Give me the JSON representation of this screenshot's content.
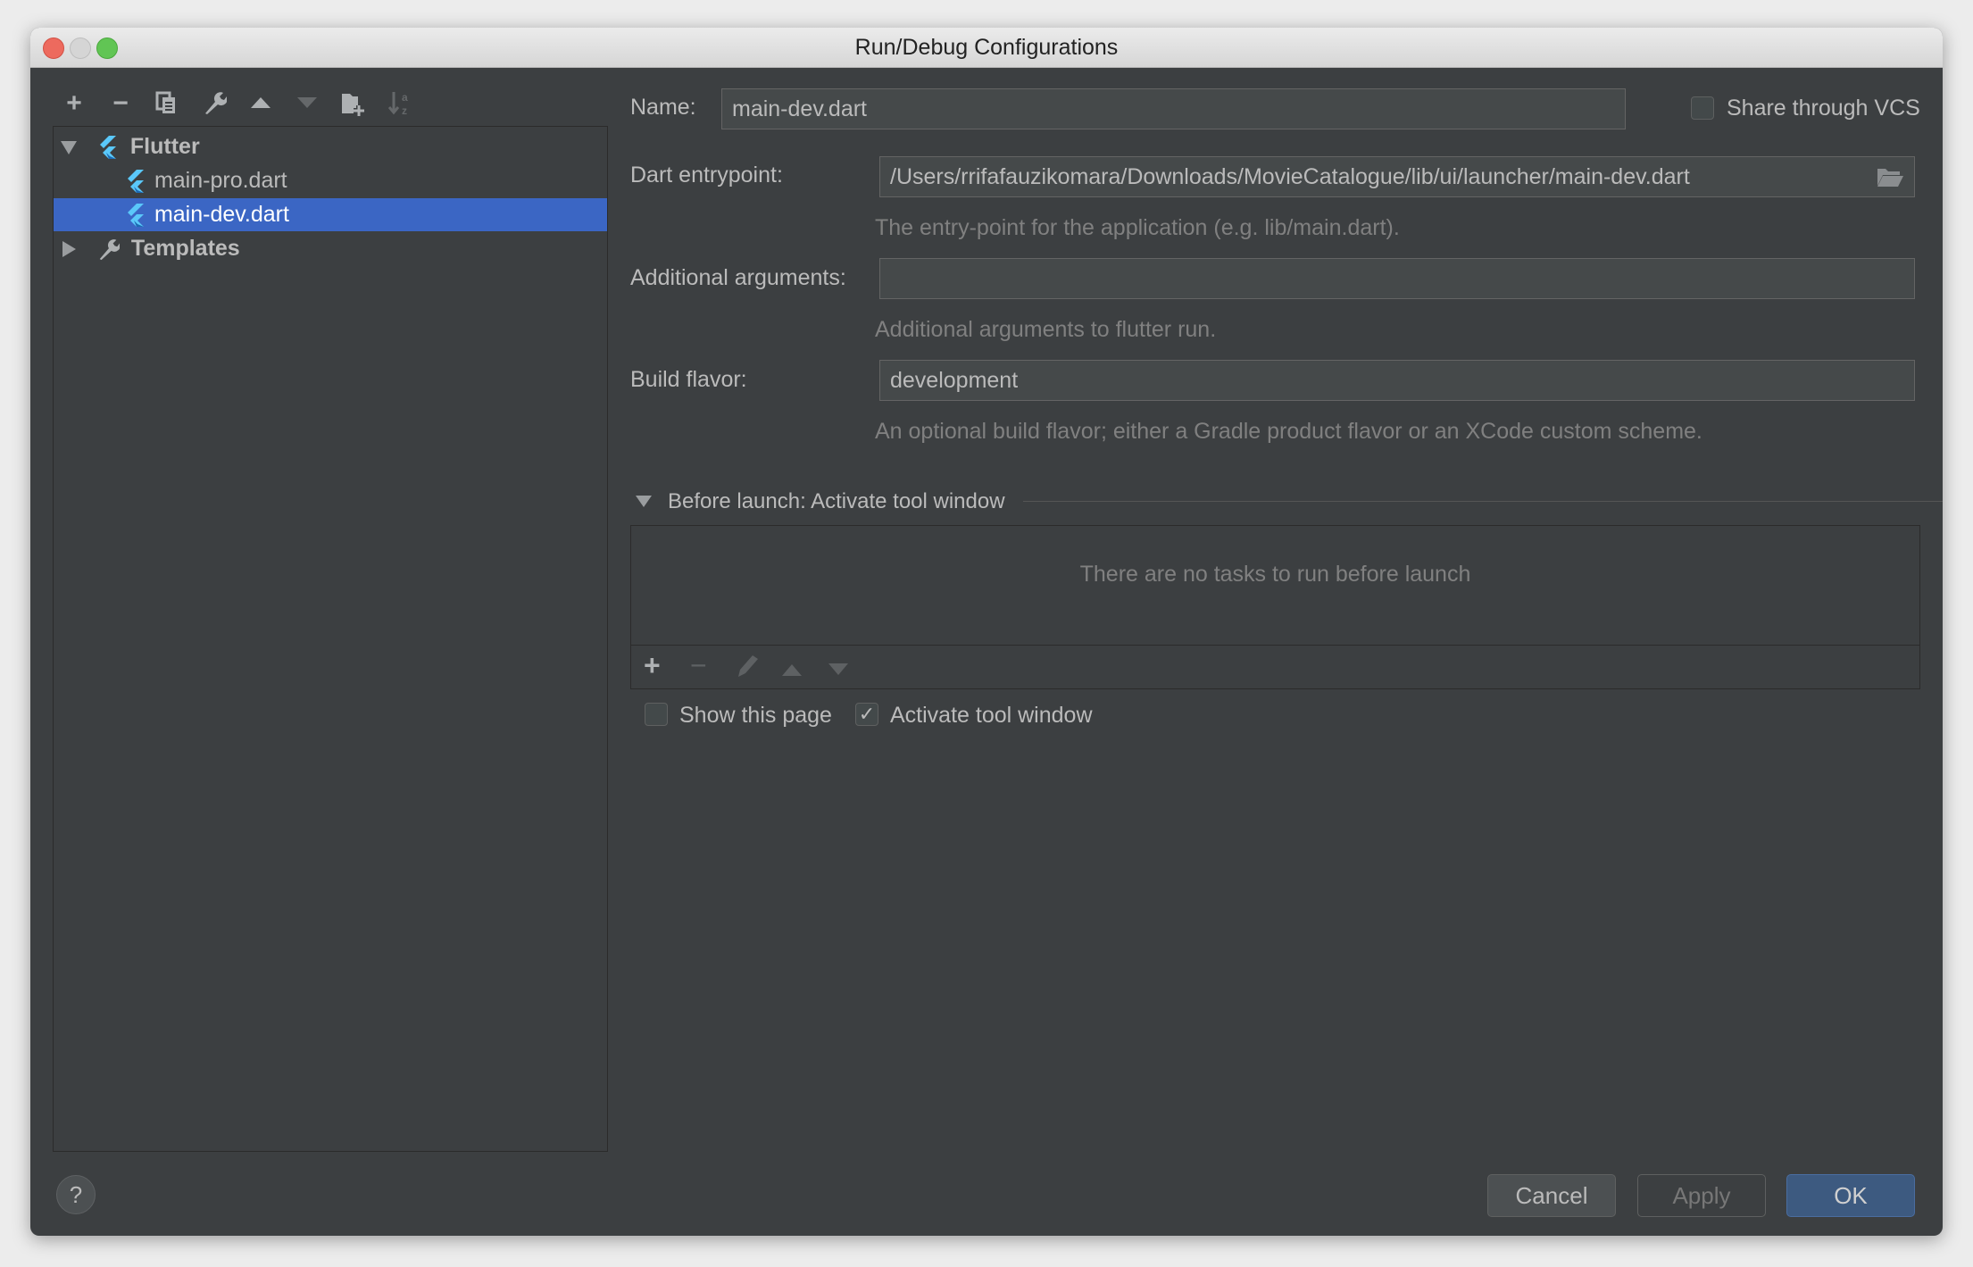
{
  "window": {
    "title": "Run/Debug Configurations"
  },
  "toolbar": {
    "icons": [
      "plus-icon",
      "minus-icon",
      "copy-icon",
      "wrench-icon",
      "arrow-up-icon",
      "arrow-down-icon",
      "new-folder-icon",
      "sort-alpha-icon"
    ]
  },
  "tree": {
    "group": "Flutter",
    "items": [
      {
        "label": "main-pro.dart",
        "selected": false
      },
      {
        "label": "main-dev.dart",
        "selected": true
      }
    ],
    "templates": "Templates"
  },
  "form": {
    "name_label": "Name:",
    "name_value": "main-dev.dart",
    "share_label": "Share through VCS",
    "share_checked": false,
    "entry_label": "Dart entrypoint:",
    "entry_value": "/Users/rrifafauzikomara/Downloads/MovieCatalogue/lib/ui/launcher/main-dev.dart",
    "entry_hint": "The entry-point for the application (e.g. lib/main.dart).",
    "args_label": "Additional arguments:",
    "args_value": "",
    "args_hint": "Additional arguments to flutter run.",
    "flavor_label": "Build flavor:",
    "flavor_value": "development",
    "flavor_hint": "An optional build flavor; either a Gradle product flavor or an XCode custom scheme."
  },
  "before_launch": {
    "title": "Before launch: Activate tool window",
    "empty_text": "There are no tasks to run before launch",
    "show_page_label": "Show this page",
    "show_page_checked": false,
    "activate_label": "Activate tool window",
    "activate_checked": true,
    "check_mark": "✓"
  },
  "buttons": {
    "help": "?",
    "cancel": "Cancel",
    "apply": "Apply",
    "ok": "OK"
  },
  "colors": {
    "selection": "#3b66c4",
    "ok_button": "#3d5a80",
    "background": "#3c3f41"
  }
}
